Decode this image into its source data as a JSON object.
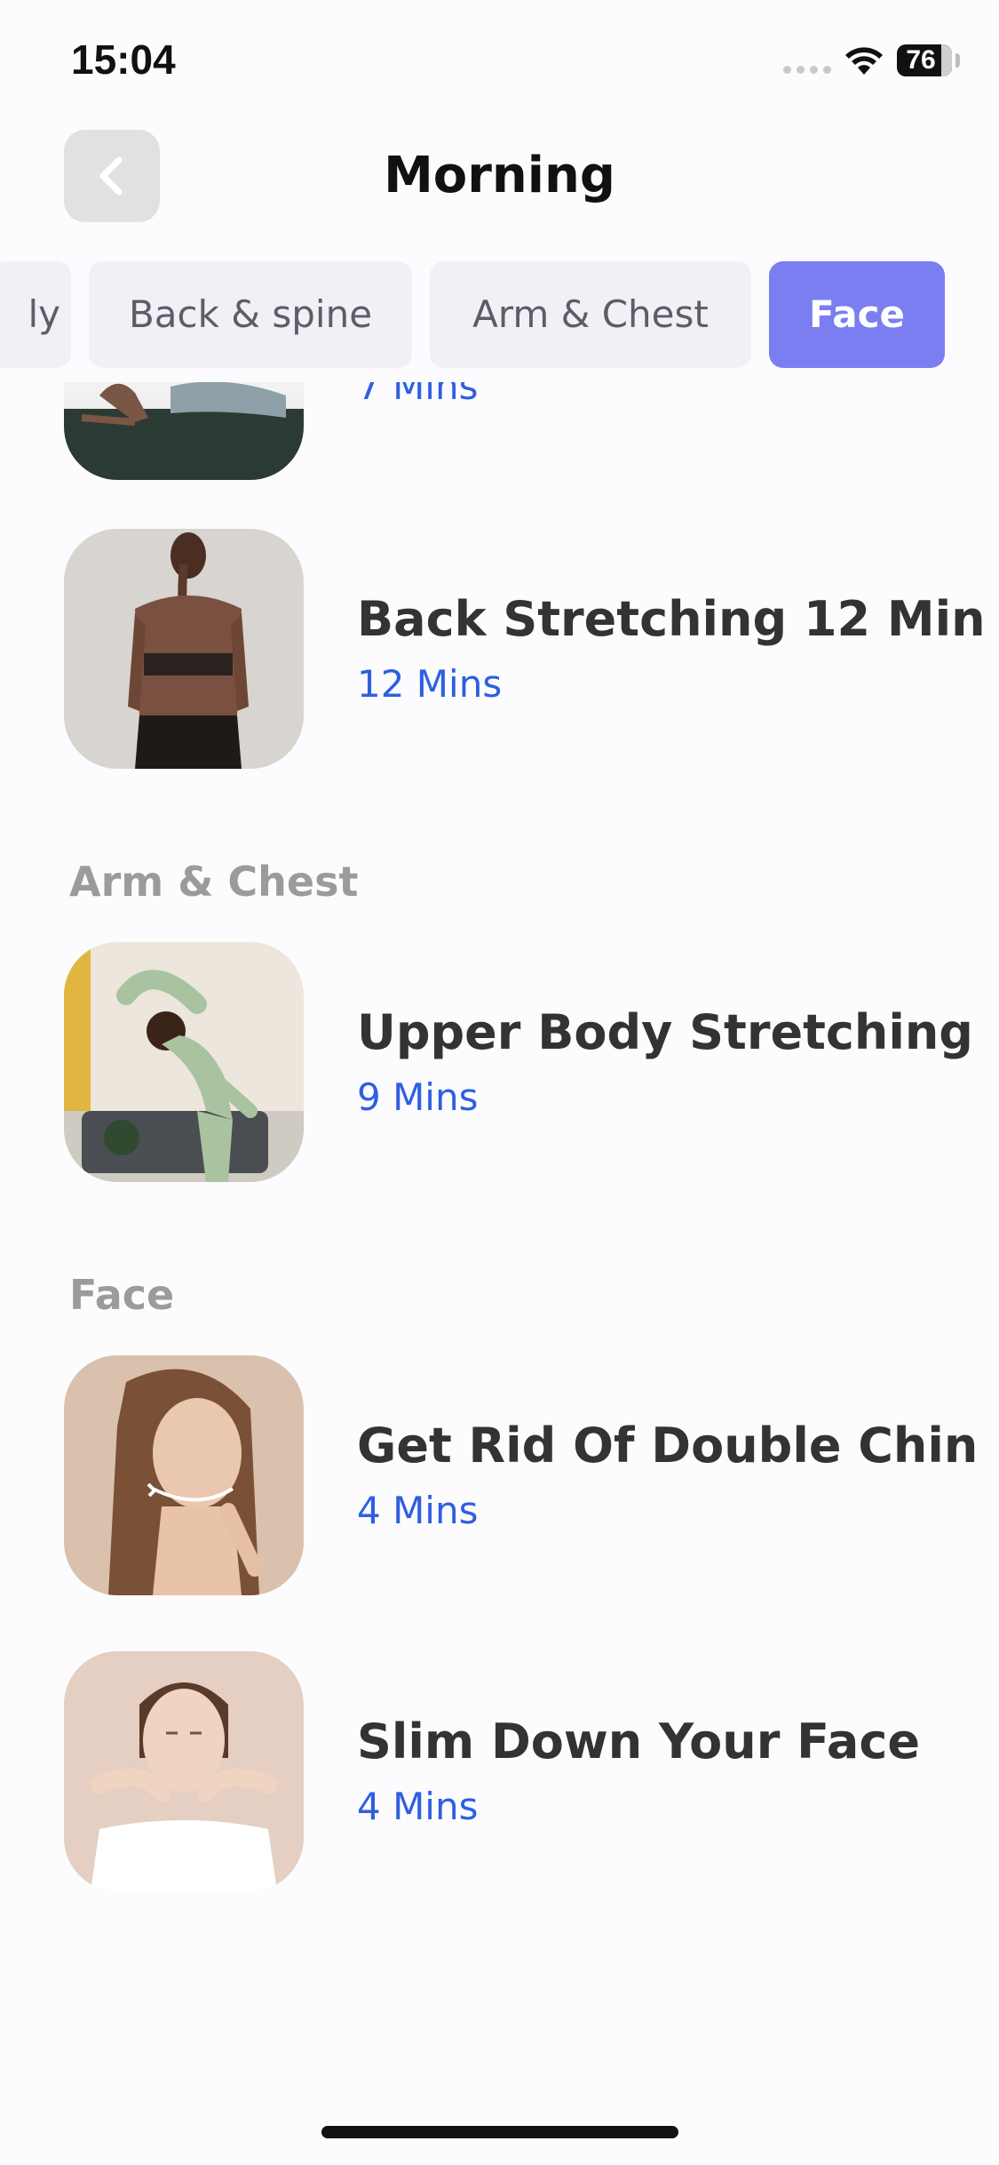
{
  "status_bar": {
    "time": "15:04",
    "battery": "76"
  },
  "header": {
    "title": "Morning",
    "back_icon": "chevron-left-icon"
  },
  "tabs": [
    {
      "label": "Full body",
      "visible_fragment": "ly",
      "active": false
    },
    {
      "label": "Back & spine",
      "active": false
    },
    {
      "label": "Arm & Chest",
      "active": false
    },
    {
      "label": "Face",
      "active": true
    }
  ],
  "colors": {
    "accent": "#7b7ef0",
    "duration": "#2e5fe0",
    "tab_bg": "#f0f1f7"
  },
  "items": {
    "partial_top": {
      "duration": "7 Mins"
    },
    "back_stretching": {
      "title": "Back Stretching 12 Min",
      "duration": "12 Mins"
    },
    "upper_body": {
      "title": "Upper Body Stretching",
      "duration": "9 Mins"
    },
    "double_chin": {
      "title": "Get Rid Of Double Chin",
      "duration": "4 Mins"
    },
    "slim_face": {
      "title": "Slim Down Your Face",
      "duration": "4 Mins"
    }
  },
  "sections": {
    "arm_chest": "Arm & Chest",
    "face": "Face"
  }
}
